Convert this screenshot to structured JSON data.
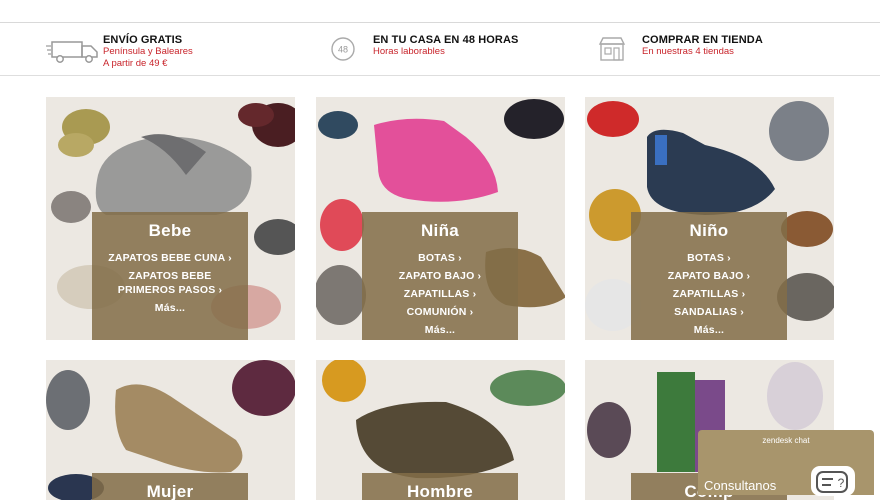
{
  "benefits": [
    {
      "icon": "truck-icon",
      "title": "ENVÍO GRATIS",
      "lines": [
        "Península y Baleares",
        "A partir de 49 €"
      ]
    },
    {
      "icon": "clock-48-icon",
      "title": "EN TU CASA EN 48 HORAS",
      "lines": [
        "Horas laborables"
      ]
    },
    {
      "icon": "store-icon",
      "title": "COMPRAR EN TIENDA",
      "lines": [
        "En nuestras 4 tiendas"
      ]
    }
  ],
  "categories": [
    {
      "title": "Bebe",
      "links": [
        "ZAPATOS BEBE CUNA ›",
        "ZAPATOS BEBE PRIMEROS PASOS ›",
        "Más..."
      ]
    },
    {
      "title": "Niña",
      "links": [
        "BOTAS ›",
        "ZAPATO BAJO ›",
        "ZAPATILLAS ›",
        "COMUNIÓN ›",
        "Más..."
      ]
    },
    {
      "title": "Niño",
      "links": [
        "BOTAS ›",
        "ZAPATO BAJO ›",
        "ZAPATILLAS ›",
        "SANDALIAS ›",
        "Más..."
      ]
    },
    {
      "title": "Mujer",
      "links": []
    },
    {
      "title": "Hombre",
      "links": []
    },
    {
      "title": "Comp",
      "links": []
    }
  ],
  "chat": {
    "brand": "zendesk chat",
    "label": "Consultanos"
  },
  "colors": {
    "accent_red": "#c8242b",
    "panel": "#826e48",
    "chat": "#a8956c"
  }
}
